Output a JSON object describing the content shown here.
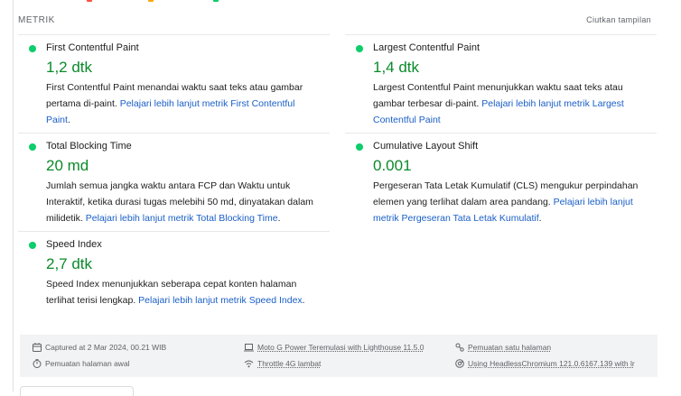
{
  "colors": {
    "pass": "#0cce6b",
    "value": "#0a8a2a",
    "link": "#1a5fc7"
  },
  "section": {
    "title": "METRIK",
    "toggle_label": "Ciutkan tampilan"
  },
  "metrics": [
    {
      "title": "First Contentful Paint",
      "value": "1,2 dtk",
      "desc": "First Contentful Paint menandai waktu saat teks atau gambar pertama di-paint. ",
      "link": "Pelajari lebih lanjut metrik First Contentful Paint",
      "suffix": "."
    },
    {
      "title": "Largest Contentful Paint",
      "value": "1,4 dtk",
      "desc": "Largest Contentful Paint menunjukkan waktu saat teks atau gambar terbesar di-paint. ",
      "link": "Pelajari lebih lanjut metrik Largest Contentful Paint",
      "suffix": ""
    },
    {
      "title": "Total Blocking Time",
      "value": "20 md",
      "desc": "Jumlah semua jangka waktu antara FCP dan Waktu untuk Interaktif, ketika durasi tugas melebihi 50 md, dinyatakan dalam milidetik. ",
      "link": "Pelajari lebih lanjut metrik Total Blocking Time",
      "suffix": "."
    },
    {
      "title": "Cumulative Layout Shift",
      "value": "0.001",
      "desc": "Pergeseran Tata Letak Kumulatif (CLS) mengukur perpindahan elemen yang terlihat dalam area pandang. ",
      "link": "Pelajari lebih lanjut metrik Pergeseran Tata Letak Kumulatif",
      "suffix": "."
    },
    {
      "title": "Speed Index",
      "value": "2,7 dtk",
      "desc": "Speed Index menunjukkan seberapa cepat konten halaman terlihat terisi lengkap. ",
      "link": "Pelajari lebih lanjut metrik Speed Index",
      "suffix": "."
    }
  ],
  "footer": {
    "captured": "Captured at 2 Mar 2024, 00.21 WIB",
    "page_load": "Pemuatan halaman awal",
    "device": "Moto G Power Teremulasi with Lighthouse 11.5.0",
    "throttle": "Throttle 4G lambat",
    "single_page": "Pemuatan satu halaman",
    "browser": "Using HeadlessChromium 121.0.6167.139 with lr"
  }
}
